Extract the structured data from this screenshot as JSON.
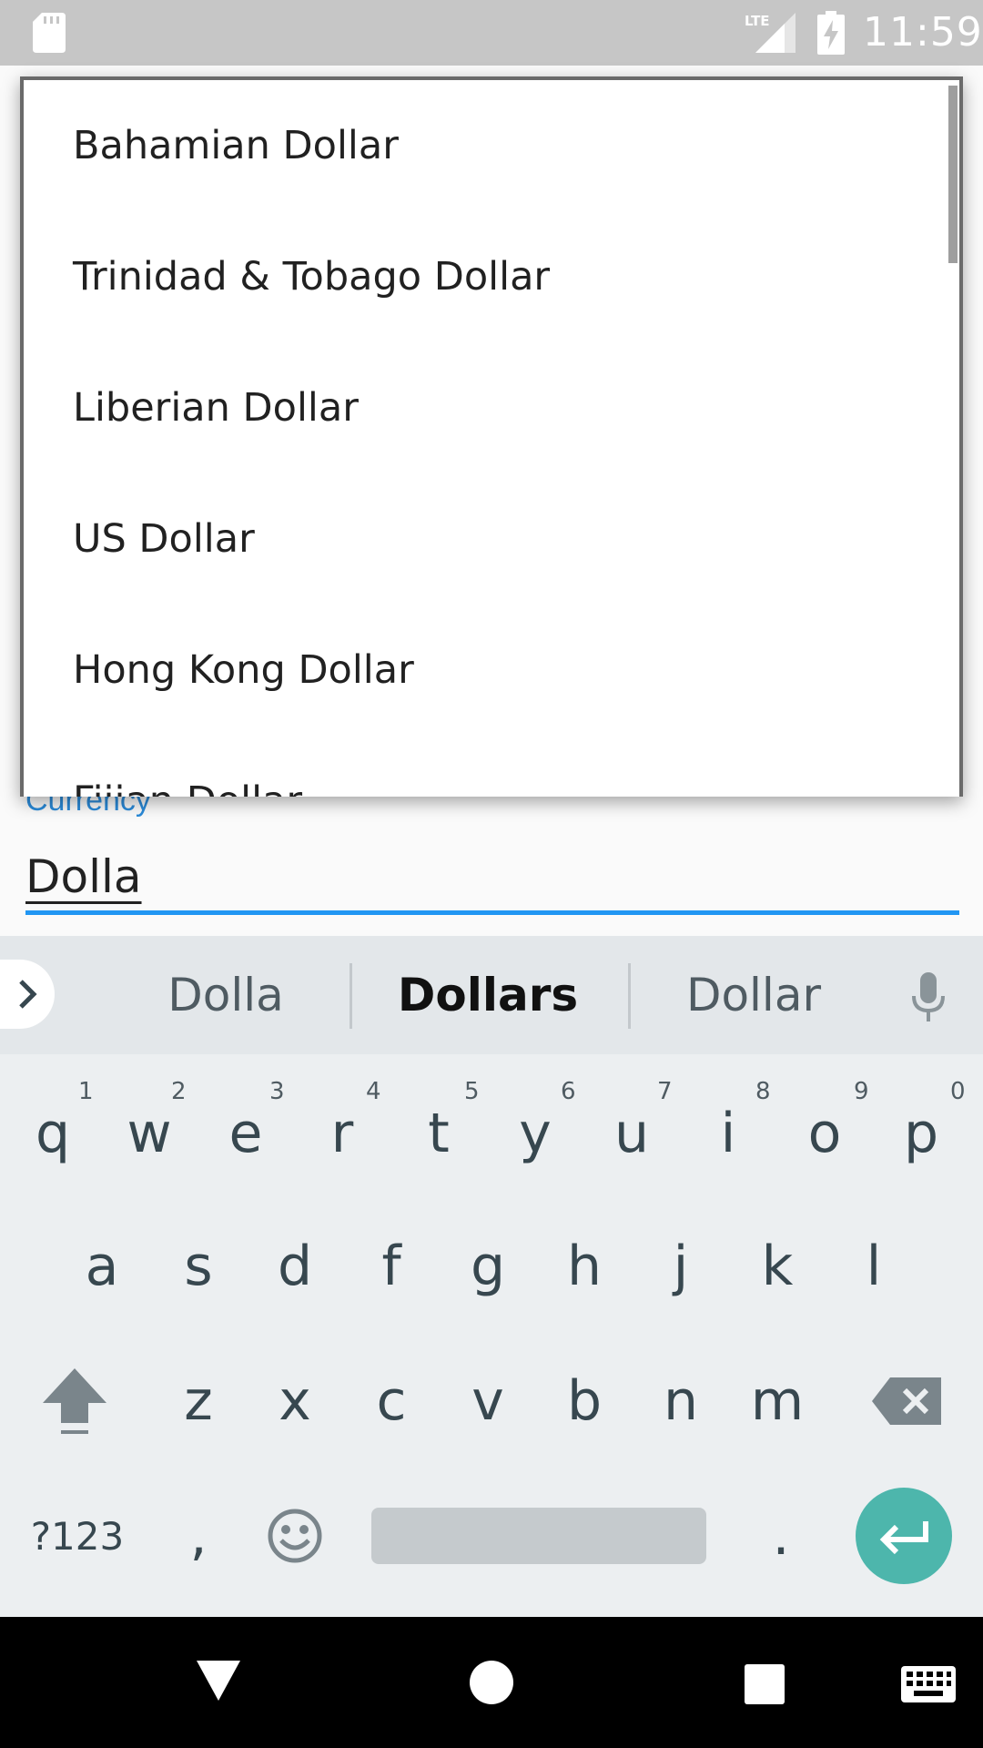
{
  "status_bar": {
    "time": "11:59",
    "network": "LTE"
  },
  "dropdown": {
    "items": [
      "Bahamian Dollar",
      "Trinidad & Tobago Dollar",
      "Liberian Dollar",
      "US Dollar",
      "Hong Kong Dollar",
      "Fijian Dollar"
    ]
  },
  "field": {
    "label": "Currency",
    "value": "Dolla"
  },
  "keyboard": {
    "suggestions": [
      "Dolla",
      "Dollars",
      "Dollar"
    ],
    "row1": [
      "q",
      "w",
      "e",
      "r",
      "t",
      "y",
      "u",
      "i",
      "o",
      "p"
    ],
    "row1_hints": [
      "1",
      "2",
      "3",
      "4",
      "5",
      "6",
      "7",
      "8",
      "9",
      "0"
    ],
    "row2": [
      "a",
      "s",
      "d",
      "f",
      "g",
      "h",
      "j",
      "k",
      "l"
    ],
    "row3": [
      "z",
      "x",
      "c",
      "v",
      "b",
      "n",
      "m"
    ],
    "symbols_label": "?123",
    "comma": ",",
    "period": "."
  },
  "colors": {
    "accent": "#2196f3",
    "enter": "#4db6ac"
  }
}
